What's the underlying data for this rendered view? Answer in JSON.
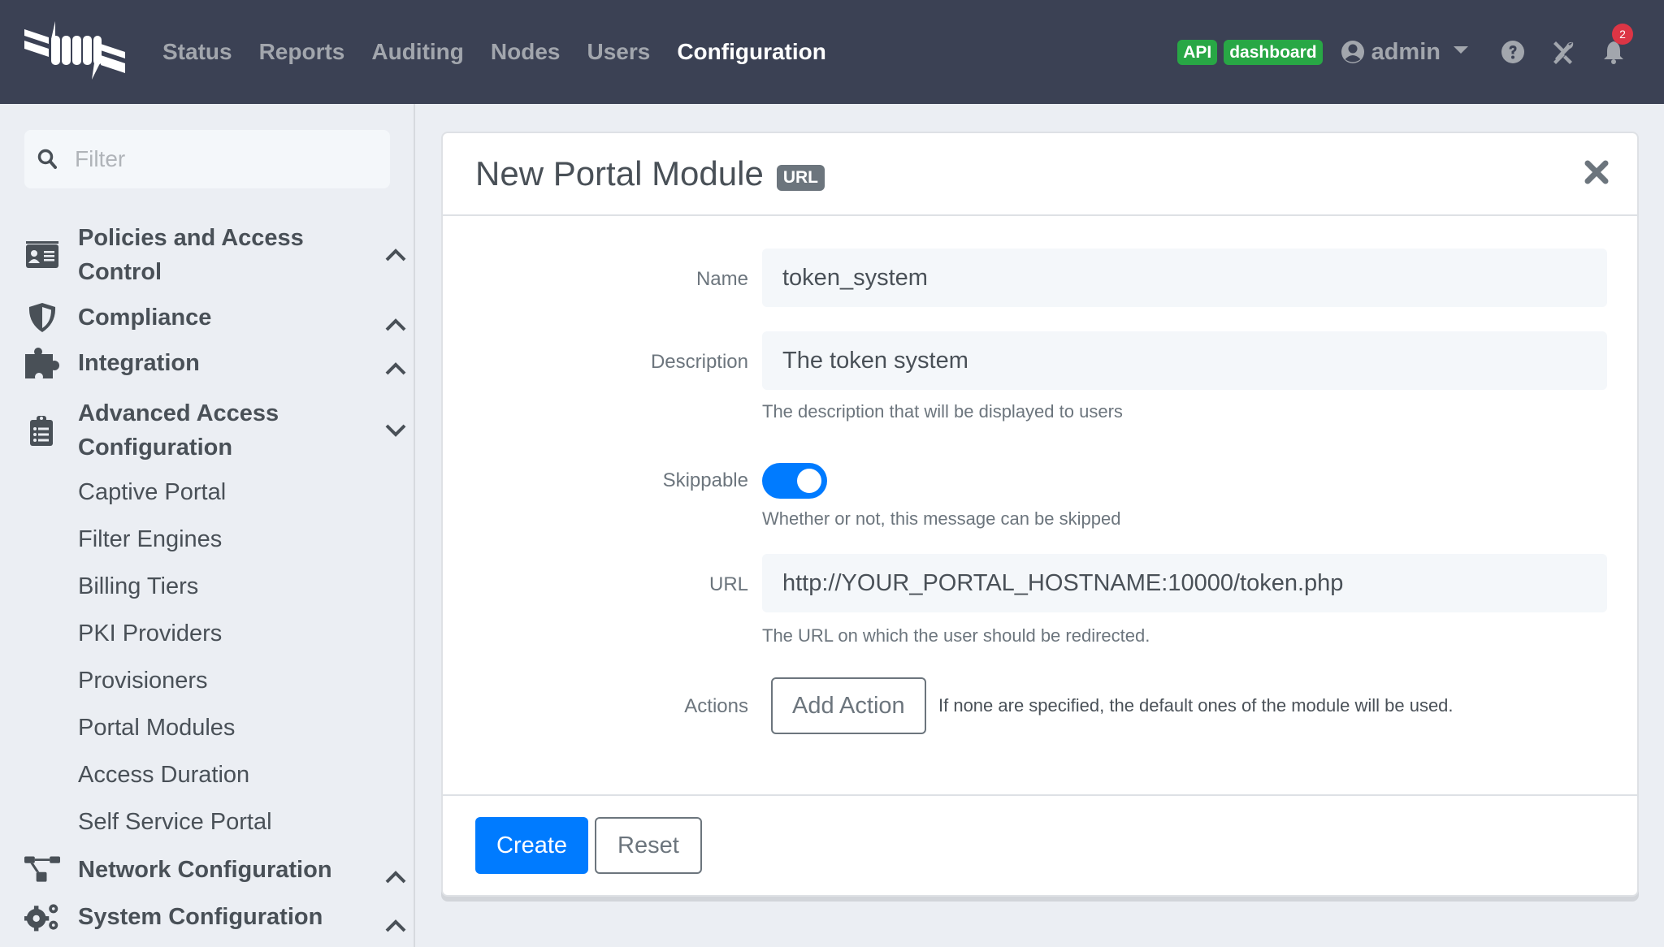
{
  "navbar": {
    "logo": "packetfence-logo",
    "links": [
      {
        "label": "Status",
        "active": false
      },
      {
        "label": "Reports",
        "active": false
      },
      {
        "label": "Auditing",
        "active": false
      },
      {
        "label": "Nodes",
        "active": false
      },
      {
        "label": "Users",
        "active": false
      },
      {
        "label": "Configuration",
        "active": true
      }
    ],
    "badges": {
      "api": "API",
      "dashboard": "dashboard"
    },
    "user": "admin",
    "icons": [
      "user-circle-icon",
      "question-circle-icon",
      "tools-icon",
      "bell-icon"
    ],
    "notifications_count": "2",
    "colors": {
      "bg": "#3b4154",
      "badge": "#28a745",
      "notification": "#dc3545"
    }
  },
  "sidebar": {
    "filter_placeholder": "Filter",
    "sections": [
      {
        "label": "Policies and Access Control",
        "icon": "id-card-icon",
        "expanded": false
      },
      {
        "label": "Compliance",
        "icon": "shield-icon",
        "expanded": false
      },
      {
        "label": "Integration",
        "icon": "puzzle-piece-icon",
        "expanded": false
      },
      {
        "label": "Advanced Access Configuration",
        "icon": "clipboard-list-icon",
        "expanded": true,
        "items": [
          "Captive Portal",
          "Filter Engines",
          "Billing Tiers",
          "PKI Providers",
          "Provisioners",
          "Portal Modules",
          "Access Duration",
          "Self Service Portal"
        ]
      },
      {
        "label": "Network Configuration",
        "icon": "network-icon",
        "expanded": false
      },
      {
        "label": "System Configuration",
        "icon": "cogs-icon",
        "expanded": false
      }
    ]
  },
  "card": {
    "title": "New Portal Module",
    "type_badge": "URL",
    "fields": {
      "name": {
        "label": "Name",
        "value": "token_system"
      },
      "description": {
        "label": "Description",
        "value": "The token system",
        "help": "The description that will be displayed to users"
      },
      "skippable": {
        "label": "Skippable",
        "checked": true,
        "help": "Whether or not, this message can be skipped"
      },
      "url": {
        "label": "URL",
        "value": "http://YOUR_PORTAL_HOSTNAME:10000/token.php",
        "help": "The URL on which the user should be redirected."
      },
      "actions": {
        "label": "Actions",
        "button": "Add Action",
        "help": "If none are specified, the default ones of the module will be used."
      }
    },
    "footer": {
      "create": "Create",
      "reset": "Reset"
    },
    "colors": {
      "primary": "#007bff",
      "secondary": "#6c757d"
    }
  }
}
